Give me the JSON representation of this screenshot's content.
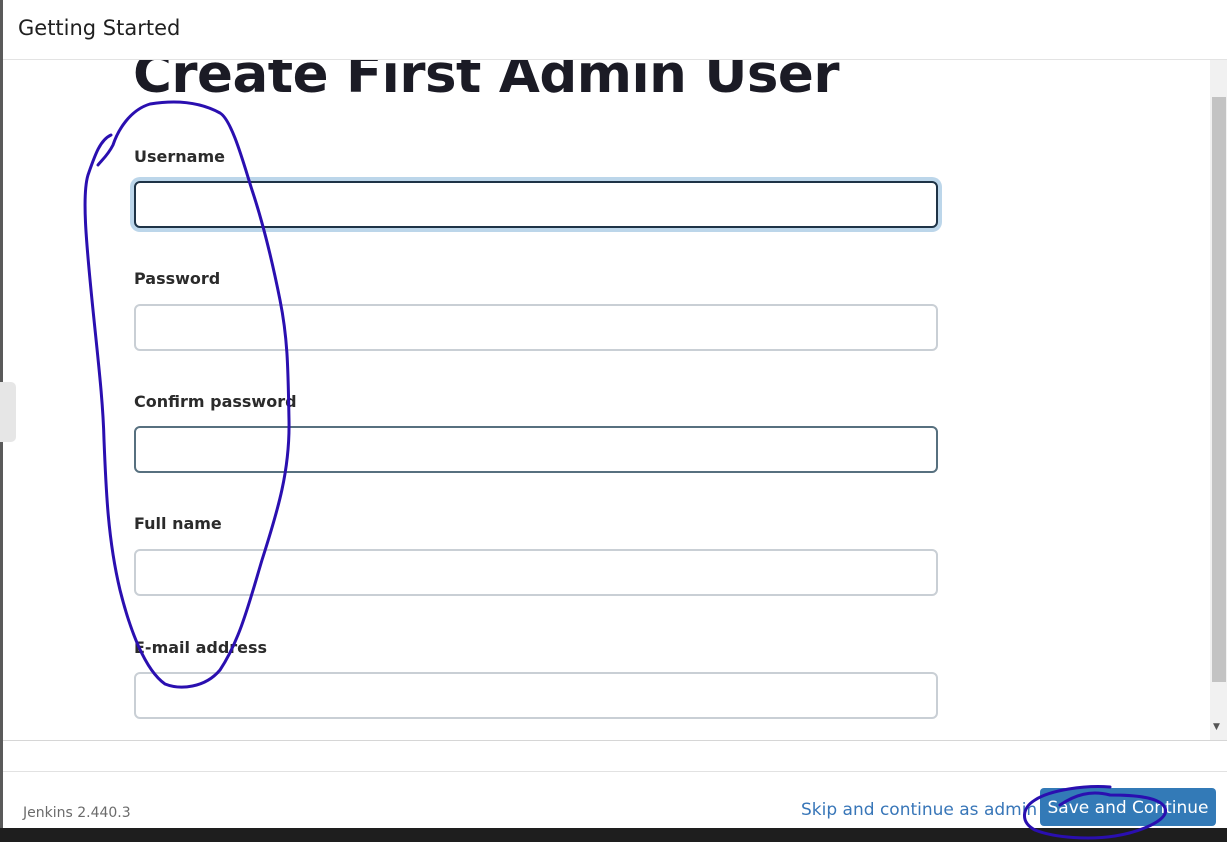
{
  "header": {
    "title": "Getting Started"
  },
  "page": {
    "title": "Create First Admin User"
  },
  "form": {
    "fields": [
      {
        "label": "Username",
        "value": ""
      },
      {
        "label": "Password",
        "value": ""
      },
      {
        "label": "Confirm password",
        "value": ""
      },
      {
        "label": "Full name",
        "value": ""
      },
      {
        "label": "E-mail address",
        "value": ""
      }
    ]
  },
  "footer": {
    "version": "Jenkins 2.440.3",
    "skip_label": "Skip and continue as admin",
    "save_label": "Save and Continue"
  },
  "colors": {
    "primary_button": "#337ab7",
    "link": "#3876b8",
    "annotation_ink": "#2a0fb0"
  }
}
